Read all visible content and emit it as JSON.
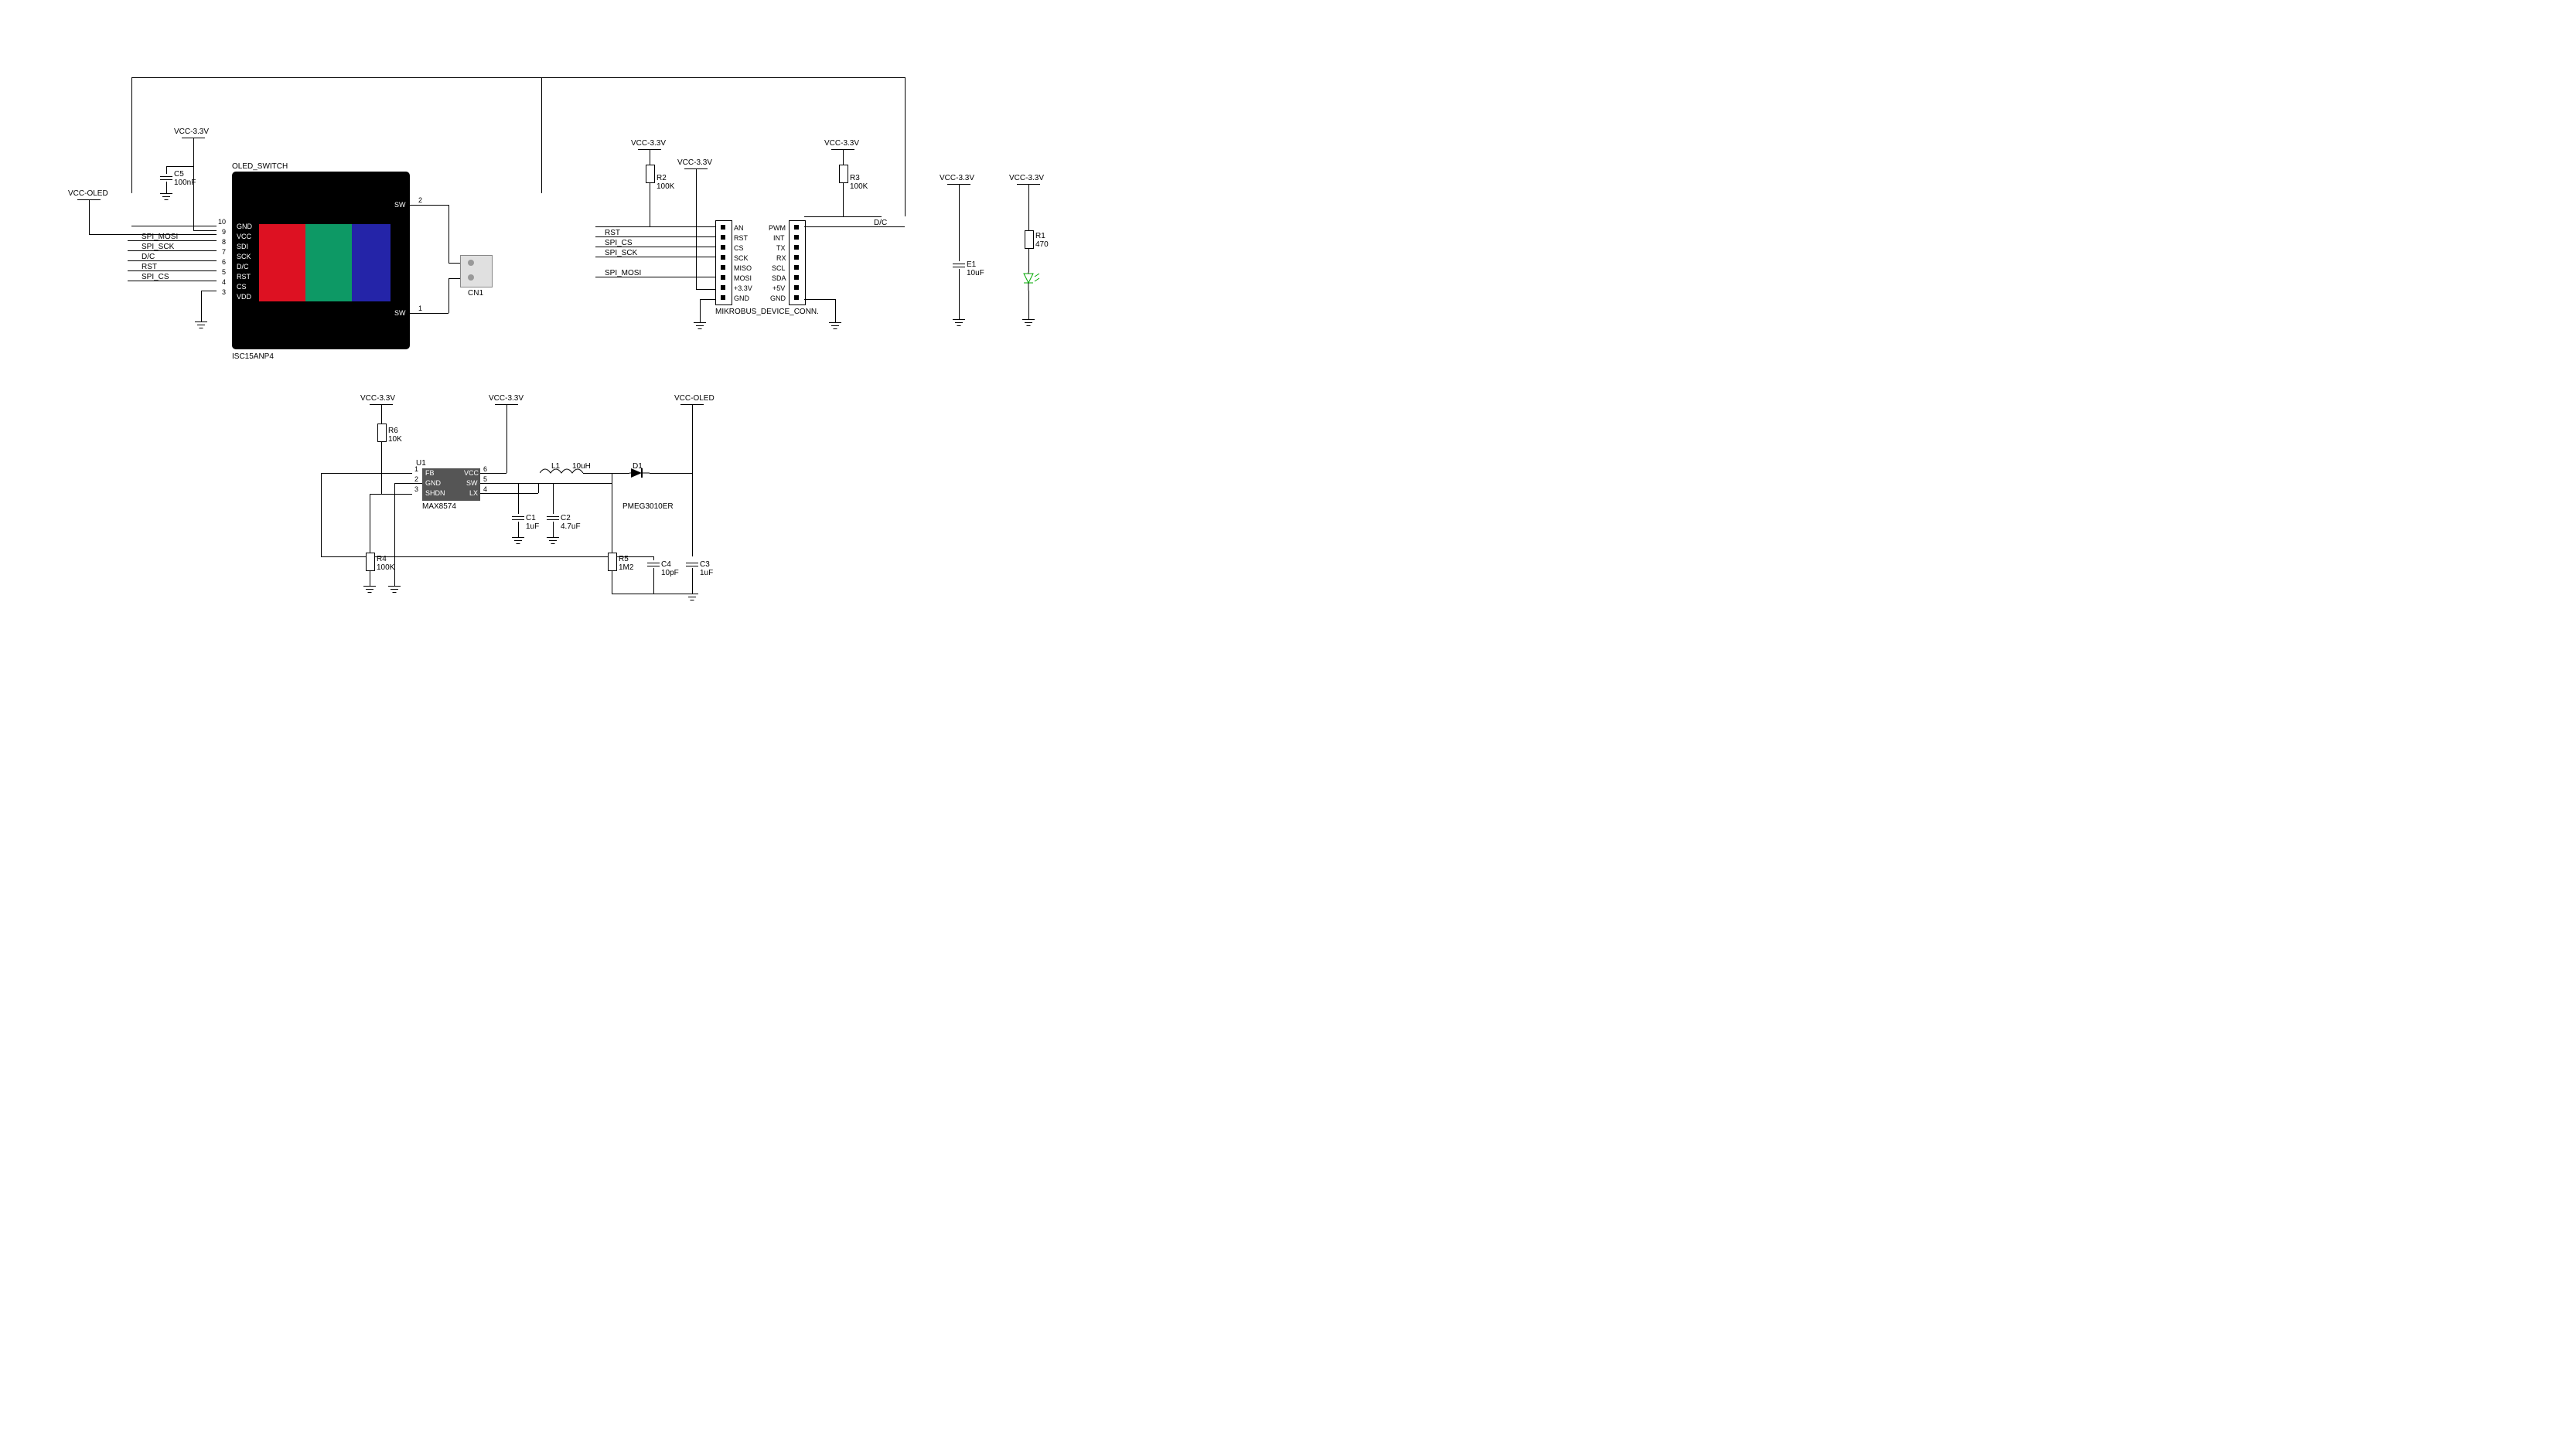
{
  "oled_switch": {
    "title": "OLED_SWITCH",
    "part": "ISC15ANP4",
    "pins": {
      "p10": "GND",
      "p9": "VCC",
      "p8": "SDI",
      "p7": "SCK",
      "p6": "D/C",
      "p5": "RST",
      "p4": "CS",
      "p3": "VDD",
      "sw_top": "SW",
      "sw_bot": "SW"
    },
    "pin_nums": {
      "n10": "10",
      "n9": "9",
      "n8": "8",
      "n7": "7",
      "n6": "6",
      "n5": "5",
      "n4": "4",
      "n3": "3",
      "n_sw_top": "2",
      "n_sw_bot": "1"
    }
  },
  "nets": {
    "vcc_oled": "VCC-OLED",
    "vcc33": "VCC-3.3V",
    "spi_mosi": "SPI_MOSI",
    "spi_sck": "SPI_SCK",
    "dc": "D/C",
    "rst": "RST",
    "spi_cs": "SPI_CS"
  },
  "cn1": "CN1",
  "c5": {
    "ref": "C5",
    "val": "100nF"
  },
  "mikrobus": {
    "title": "MIKROBUS_DEVICE_CONN.",
    "left": {
      "an": "AN",
      "rst": "RST",
      "cs": "CS",
      "sck": "SCK",
      "miso": "MISO",
      "mosi": "MOSI",
      "v33": "+3.3V",
      "gnd": "GND"
    },
    "right": {
      "pwm": "PWM",
      "int": "INT",
      "tx": "TX",
      "rx": "RX",
      "scl": "SCL",
      "sda": "SDA",
      "v5": "+5V",
      "gnd": "GND"
    }
  },
  "r2": {
    "ref": "R2",
    "val": "100K"
  },
  "r3": {
    "ref": "R3",
    "val": "100K"
  },
  "e1": {
    "ref": "E1",
    "val": "10uF"
  },
  "r1": {
    "ref": "R1",
    "val": "470"
  },
  "u1": {
    "ref": "U1",
    "part": "MAX8574",
    "pins": {
      "fb": "FB",
      "gnd": "GND",
      "shdn": "SHDN",
      "vcc": "VCC",
      "sw": "SW",
      "lx": "LX"
    },
    "nums": {
      "p1": "1",
      "p2": "2",
      "p3": "3",
      "p4": "4",
      "p5": "5",
      "p6": "6"
    }
  },
  "r6": {
    "ref": "R6",
    "val": "10K"
  },
  "r4": {
    "ref": "R4",
    "val": "100K"
  },
  "r5": {
    "ref": "R5",
    "val": "1M2"
  },
  "c1": {
    "ref": "C1",
    "val": "1uF"
  },
  "c2": {
    "ref": "C2",
    "val": "4.7uF"
  },
  "c3": {
    "ref": "C3",
    "val": "1uF"
  },
  "c4": {
    "ref": "C4",
    "val": "10pF"
  },
  "l1": {
    "ref": "L1",
    "val": "10uH"
  },
  "d1": {
    "ref": "D1",
    "part": "PMEG3010ER"
  }
}
